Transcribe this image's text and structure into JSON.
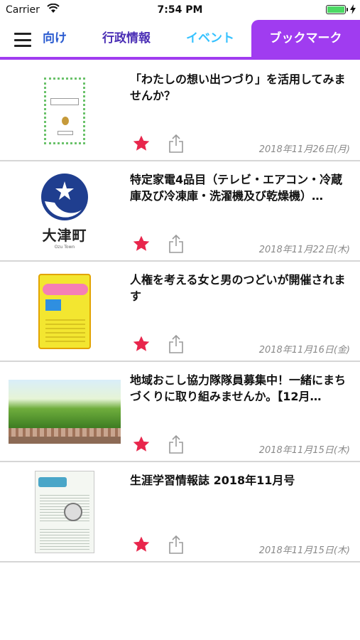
{
  "status_bar": {
    "carrier": "Carrier",
    "time": "7:54 PM"
  },
  "nav": {
    "tabs": [
      {
        "label": "向け"
      },
      {
        "label": "行政情報"
      },
      {
        "label": "イベント"
      },
      {
        "label": "ブックマーク",
        "selected": true
      }
    ],
    "accent_color": "#a03cf0"
  },
  "thumb_text": {
    "otsu": "大津町",
    "otsu_sub": "Ozu Town"
  },
  "items": [
    {
      "title": "「わたしの想い出つづり」を活用してみませんか？",
      "date": "2018年11月26日(月)",
      "bookmarked": true
    },
    {
      "title": "特定家電4品目（テレビ・エアコン・冷蔵庫及び冷凍庫・洗濯機及び乾燥機）…",
      "date": "2018年11月22日(木)",
      "bookmarked": true
    },
    {
      "title": "人権を考える女と男のつどいが開催されます",
      "date": "2018年11月16日(金)",
      "bookmarked": true
    },
    {
      "title": "地域おこし協力隊隊員募集中！一緒にまちづくりに取り組みませんか。【12月…",
      "date": "2018年11月15日(木)",
      "bookmarked": true
    },
    {
      "title": "生涯学習情報誌 2018年11月号",
      "date": "2018年11月15日(木)",
      "bookmarked": true
    }
  ]
}
